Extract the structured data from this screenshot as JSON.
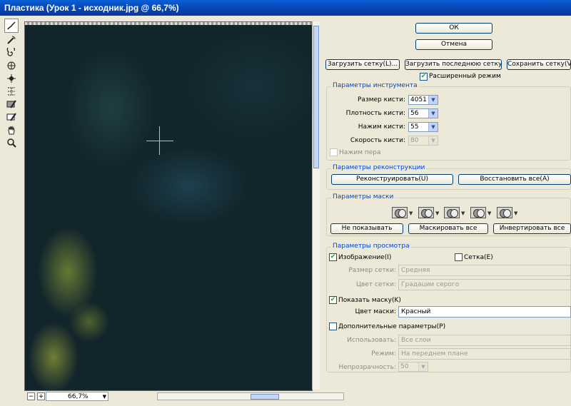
{
  "window": {
    "title": "Пластика (Урок 1 - исходник.jpg @ 66,7%)"
  },
  "tools": [
    {
      "name": "forward-warp-icon",
      "active": true
    },
    {
      "name": "reconstruct-icon"
    },
    {
      "name": "twirl-icon"
    },
    {
      "name": "pucker-icon"
    },
    {
      "name": "bloat-icon"
    },
    {
      "name": "push-left-icon"
    },
    {
      "name": "freeze-mask-icon"
    },
    {
      "name": "thaw-mask-icon"
    },
    {
      "name": "hand-icon"
    },
    {
      "name": "zoom-icon"
    }
  ],
  "preview": {
    "zoom": "66,7%"
  },
  "actions": {
    "ok": "ОК",
    "cancel": "Отмена"
  },
  "mesh": {
    "load": "Загрузить сетку(L)...",
    "load_last": "Загрузить последнюю сетку",
    "save": "Сохранить сетку(V)...",
    "advanced_mode": "Расширенный режим",
    "advanced_checked": true
  },
  "tool_options": {
    "title": "Параметры инструмента",
    "brush_size_label": "Размер кисти:",
    "brush_size": "4051",
    "brush_density_label": "Плотность кисти:",
    "brush_density": "56",
    "brush_pressure_label": "Нажим кисти:",
    "brush_pressure": "55",
    "brush_rate_label": "Скорость кисти:",
    "brush_rate": "80",
    "stylus_pressure": "Нажим пера"
  },
  "reconstruct": {
    "title": "Параметры реконструкции",
    "reconstruct": "Реконструировать(U)",
    "restore_all": "Восстановить все(A)"
  },
  "mask": {
    "title": "Параметры маски",
    "none": "Не показывать",
    "mask_all": "Маскировать все",
    "invert_all": "Инвертировать все"
  },
  "view": {
    "title": "Параметры просмотра",
    "image": "Изображение(I)",
    "image_checked": true,
    "mesh": "Сетка(E)",
    "mesh_checked": false,
    "mesh_size_label": "Размер сетки:",
    "mesh_size": "Средняя",
    "mesh_color_label": "Цвет сетки:",
    "mesh_color": "Градации серого",
    "show_mask": "Показать маску(K)",
    "show_mask_checked": true,
    "mask_color_label": "Цвет маски:",
    "mask_color": "Красный",
    "extra": "Дополнительные параметры(P)",
    "extra_checked": false,
    "use_label": "Использовать:",
    "use": "Все слои",
    "mode_label": "Режим:",
    "mode": "На переднем плане",
    "opacity_label": "Непрозрачность:",
    "opacity": "50"
  }
}
